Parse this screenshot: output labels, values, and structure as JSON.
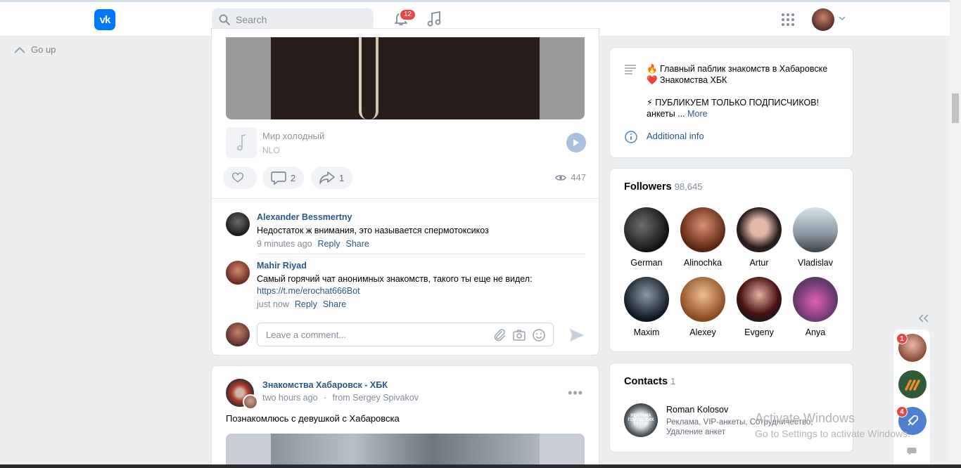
{
  "header": {
    "logo_text": "vk",
    "search_placeholder": "Search",
    "notifications_count": "12"
  },
  "nav": {
    "go_up": "Go up"
  },
  "post1": {
    "audio": {
      "title": "Мир холодный",
      "artist": "NLO"
    },
    "actions": {
      "comments": "2",
      "shares": "1",
      "views": "447"
    },
    "comments": [
      {
        "author": "Alexander Bessmertny",
        "text": "Недостаток ж внимания, это называется спермотоксикоз",
        "time": "9 minutes ago",
        "reply": "Reply",
        "share": "Share"
      },
      {
        "author": "Mahir Riyad",
        "text": "Самый горячий чат анонимных знакомств, такого ты еще не видел:",
        "link": "https://t.me/erochat666Bot",
        "time": "just now",
        "reply": "Reply",
        "share": "Share"
      }
    ],
    "comment_placeholder": "Leave a comment..."
  },
  "post2": {
    "author": "Знакомства Хабаровск - ХБК",
    "time": "two hours ago",
    "separator": "·",
    "from": "from Sergey Spivakov",
    "text": "Познакомлюсь с девушкой с Хабаровска"
  },
  "info": {
    "line1": "🔥 Главный паблик знакомств в Хабаровске",
    "line2": "❤️ Знакомства ХБК",
    "line3": "⚡ ПУБЛИКУЕМ ТОЛЬКО ПОДПИСЧИКОВ!",
    "line4_prefix": "анкеты ... ",
    "more": "More",
    "additional": "Additional info"
  },
  "followers": {
    "title": "Followers",
    "count": "98,645",
    "items": [
      {
        "name": "German",
        "color": "#2b2b2b"
      },
      {
        "name": "Alinochka",
        "color": "#8a4a2e"
      },
      {
        "name": "Artur",
        "color": "#3a2a28"
      },
      {
        "name": "Vladislav",
        "color": "#9aa6b2"
      },
      {
        "name": "Maxim",
        "color": "#1f2a36"
      },
      {
        "name": "Alexey",
        "color": "#b0703c"
      },
      {
        "name": "Evgeny",
        "color": "#6a2222"
      },
      {
        "name": "Anya",
        "color": "#7a4a7e"
      }
    ]
  },
  "contacts": {
    "title": "Contacts",
    "count": "1",
    "avatar_text": "РЕКЛАМА ГОРОДСКИХ ГРУПП",
    "name": "Roman Kolosov",
    "desc": "Реклама, VIP-анкеты, Сотрудничество, Удаление анкет"
  },
  "chats": {
    "badge1": "1",
    "badge2": "4"
  },
  "watermark": {
    "line1": "Activate Windows",
    "line2": "Go to Settings to activate Windows."
  }
}
